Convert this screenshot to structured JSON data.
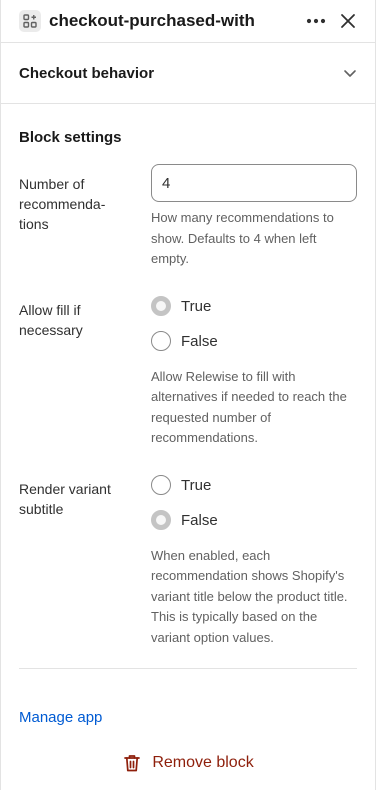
{
  "header": {
    "title": "checkout-purchased-with",
    "block_icon": "apps-block-icon",
    "more_icon": "more-horizontal-icon",
    "close_icon": "close-icon"
  },
  "accordion": {
    "title": "Checkout behavior",
    "icon": "chevron-down-icon"
  },
  "block_settings": {
    "title": "Block settings",
    "recommendations": {
      "label": "Number of recommenda-tions",
      "value": "4",
      "help": "How many recommendations to show. Defaults to 4 when left empty."
    },
    "allow_fill": {
      "label": "Allow fill if necessary",
      "options": [
        {
          "label": "True",
          "checked": true
        },
        {
          "label": "False",
          "checked": false
        }
      ],
      "help": "Allow Relewise to fill with alternatives if needed to reach the requested number of recommendations."
    },
    "render_variant": {
      "label": "Render variant subtitle",
      "options": [
        {
          "label": "True",
          "checked": false
        },
        {
          "label": "False",
          "checked": true
        }
      ],
      "help": "When enabled, each recommendation shows Shopify's variant title below the product title. This is typically based on the variant option values."
    }
  },
  "footer": {
    "manage_label": "Manage app",
    "remove_label": "Remove block",
    "remove_icon": "trash-icon"
  },
  "colors": {
    "link": "#005bd3",
    "critical": "#8e1f0b",
    "border": "#e3e3e3"
  }
}
